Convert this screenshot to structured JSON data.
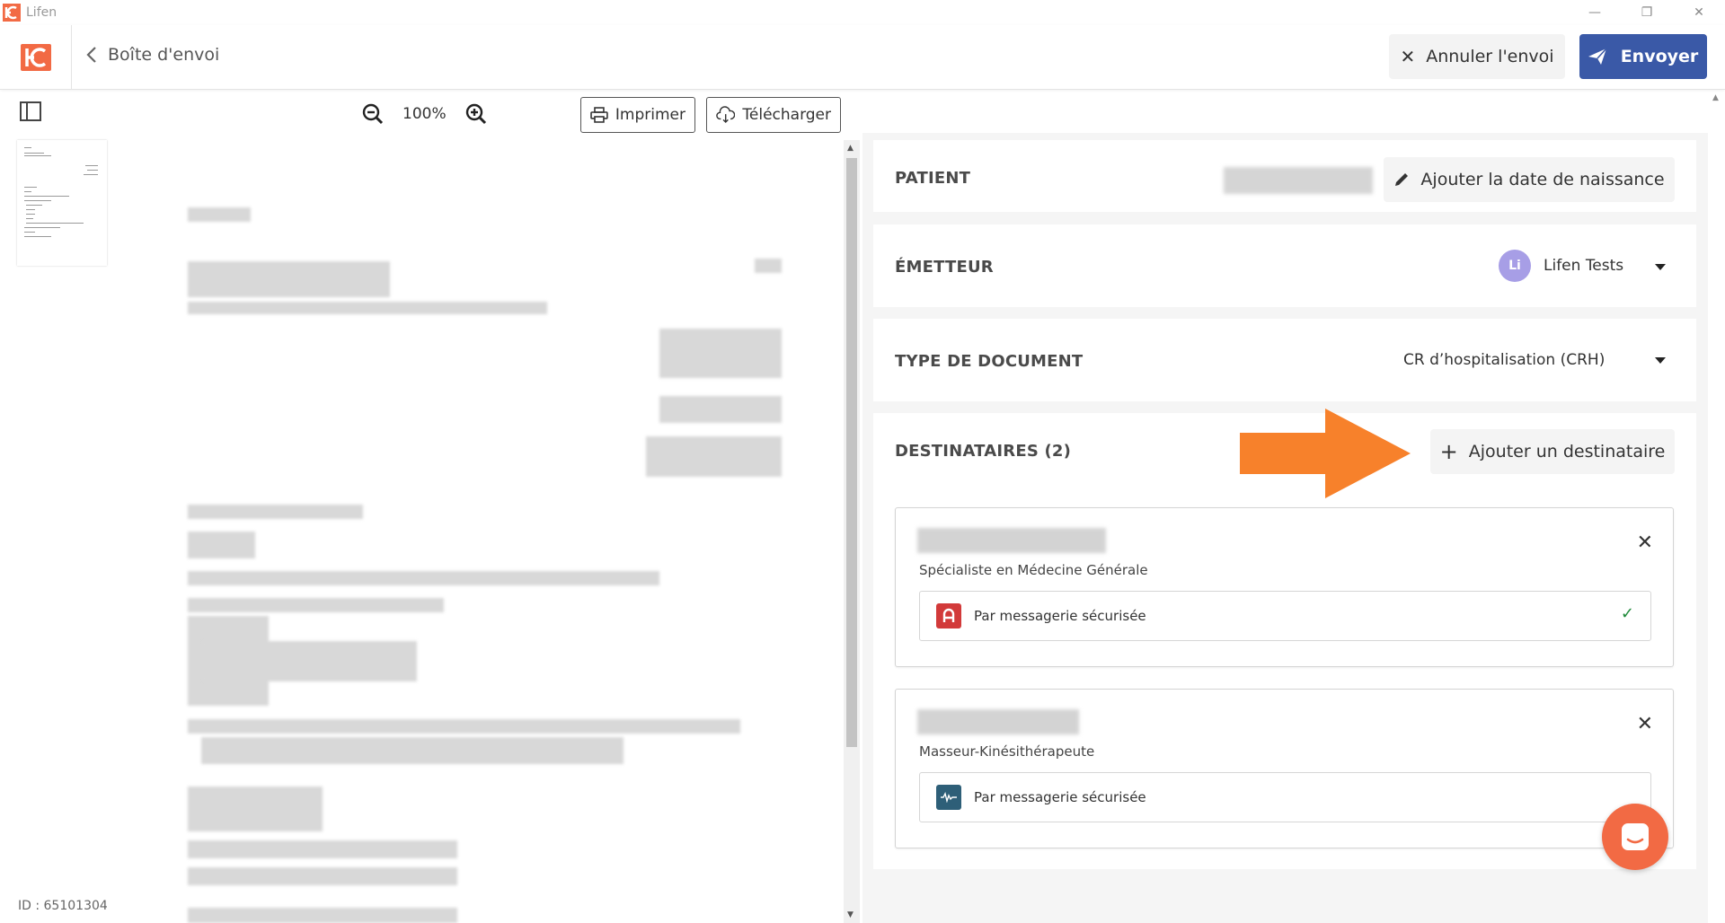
{
  "window": {
    "title": "Lifen",
    "minimize_icon": "—",
    "restore_icon": "❐",
    "close_icon": "✕"
  },
  "header": {
    "back_label": "Boîte d'envoi",
    "cancel_label": "Annuler l'envoi",
    "send_label": "Envoyer",
    "brand_color": "#f26a44",
    "send_color": "#3a59a7"
  },
  "viewer": {
    "zoom_level": "100%",
    "print_label": "Imprimer",
    "download_label": "Télécharger",
    "document_id": "ID : 65101304"
  },
  "patient": {
    "label": "PATIENT",
    "add_birthdate_label": "Ajouter la date de naissance"
  },
  "sender": {
    "label": "ÉMETTEUR",
    "avatar_initials": "Li",
    "name": "Lifen Tests"
  },
  "document_type": {
    "label": "TYPE DE DOCUMENT",
    "value": "CR d’hospitalisation (CRH)"
  },
  "recipients": {
    "label": "DESTINATAIRES (2)",
    "add_label": "Ajouter un destinataire",
    "items": [
      {
        "role": "Spécialiste en Médecine Générale",
        "channel": "Par messagerie sécurisée",
        "channel_icon": "apicrypt-icon",
        "selected": true
      },
      {
        "role": "Masseur-Kinésithérapeute",
        "channel": "Par messagerie sécurisée",
        "channel_icon": "mssante-icon",
        "selected": false
      }
    ]
  },
  "annotation": {
    "arrow_color": "#f7812b"
  }
}
